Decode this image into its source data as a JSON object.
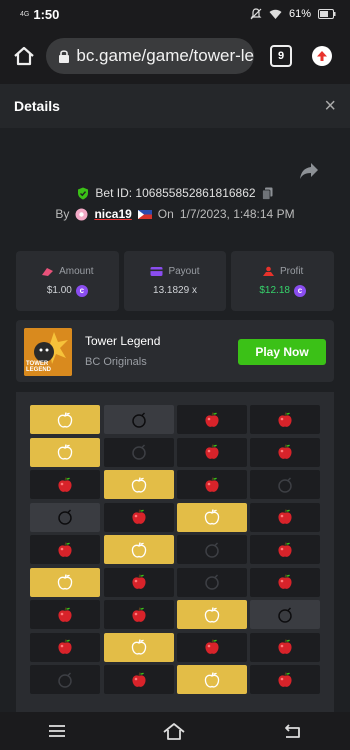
{
  "status_bar": {
    "network": "4G",
    "time": "1:50",
    "battery": "61%"
  },
  "browser": {
    "url": "bc.game/game/tower-le",
    "tab_count": "9"
  },
  "details": {
    "title": "Details",
    "close": "×"
  },
  "bet": {
    "id_label": "Bet ID: 106855852861816862",
    "by_label": "By",
    "user": "nica19",
    "on_label": "On",
    "datetime": "1/7/2023, 1:48:14 PM"
  },
  "stats": {
    "amount": {
      "label": "Amount",
      "value": "$1.00"
    },
    "payout": {
      "label": "Payout",
      "value": "13.1829 x"
    },
    "profit": {
      "label": "Profit",
      "value": "$12.18"
    }
  },
  "game": {
    "name": "Tower Legend",
    "provider": "BC Originals",
    "play_label": "Play Now",
    "thumb_text": "TOWER LEGEND"
  },
  "colors": {
    "accent_green": "#3bc117",
    "profit_green": "#36d36b",
    "gold_tile": "#e3bd47",
    "coin_purple": "#8a4df0"
  },
  "board": {
    "rows": [
      [
        "gold-apple",
        "bomb",
        "apple",
        "apple"
      ],
      [
        "gold-apple",
        "dark-bomb",
        "apple",
        "apple"
      ],
      [
        "apple",
        "gold-apple",
        "apple",
        "dark-bomb"
      ],
      [
        "bomb",
        "apple",
        "gold-apple",
        "apple"
      ],
      [
        "apple",
        "gold-apple",
        "dark-bomb",
        "apple"
      ],
      [
        "gold-apple",
        "apple",
        "dark-bomb",
        "apple"
      ],
      [
        "apple",
        "apple",
        "gold-apple",
        "bomb"
      ],
      [
        "apple",
        "gold-apple",
        "apple",
        "apple"
      ],
      [
        "dark-bomb",
        "apple",
        "gold-apple",
        "apple"
      ]
    ]
  }
}
